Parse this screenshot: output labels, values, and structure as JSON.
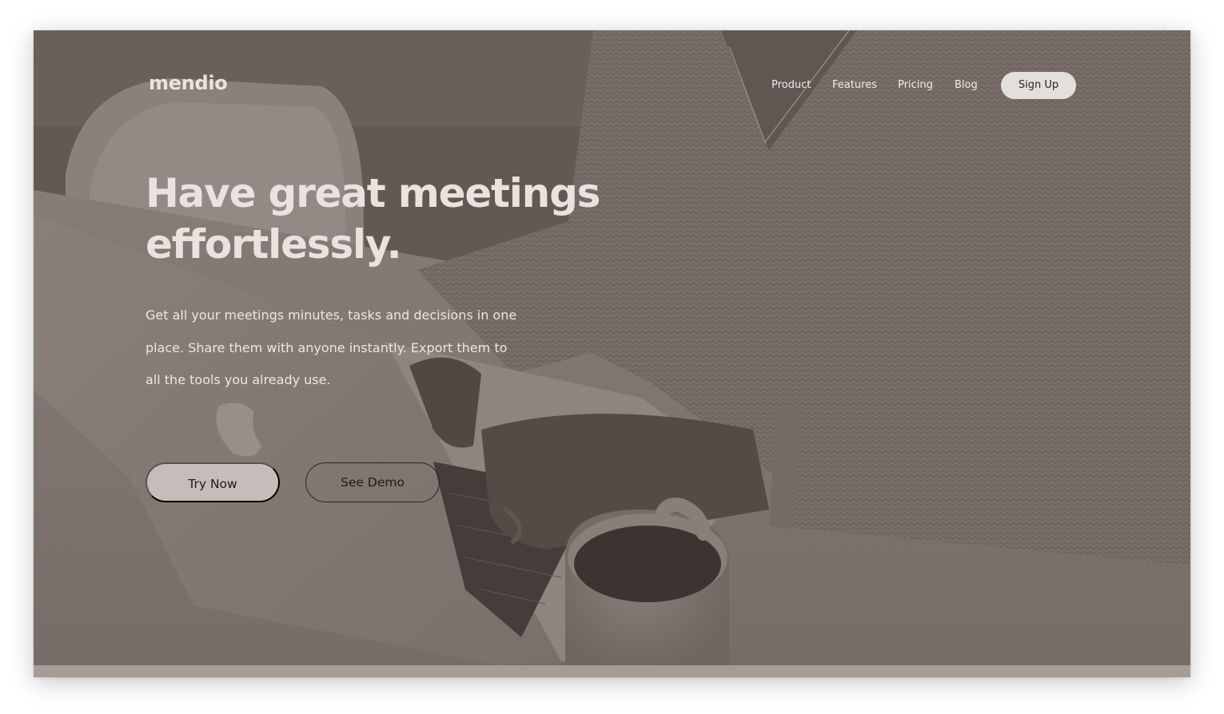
{
  "brand": {
    "logo": "mendio"
  },
  "nav": {
    "links": [
      "Product",
      "Features",
      "Pricing",
      "Blog"
    ],
    "signup_label": "Sign Up"
  },
  "hero": {
    "headline_line1": "Have great meetings",
    "headline_line2": "effortlessly.",
    "subtext_line1": "Get all your meetings minutes, tasks and decisions in one",
    "subtext_line2": "place. Share them with anyone instantly. Export them to",
    "subtext_line3": "all the tools you already use.",
    "primary_cta": "Try Now",
    "secondary_cta": "See Demo"
  },
  "colors": {
    "overlay_tint": "#7a6f69",
    "heading_text": "#e9e2de",
    "primary_button": "#c5bdb9",
    "signup_button": "#e3dfdd"
  }
}
